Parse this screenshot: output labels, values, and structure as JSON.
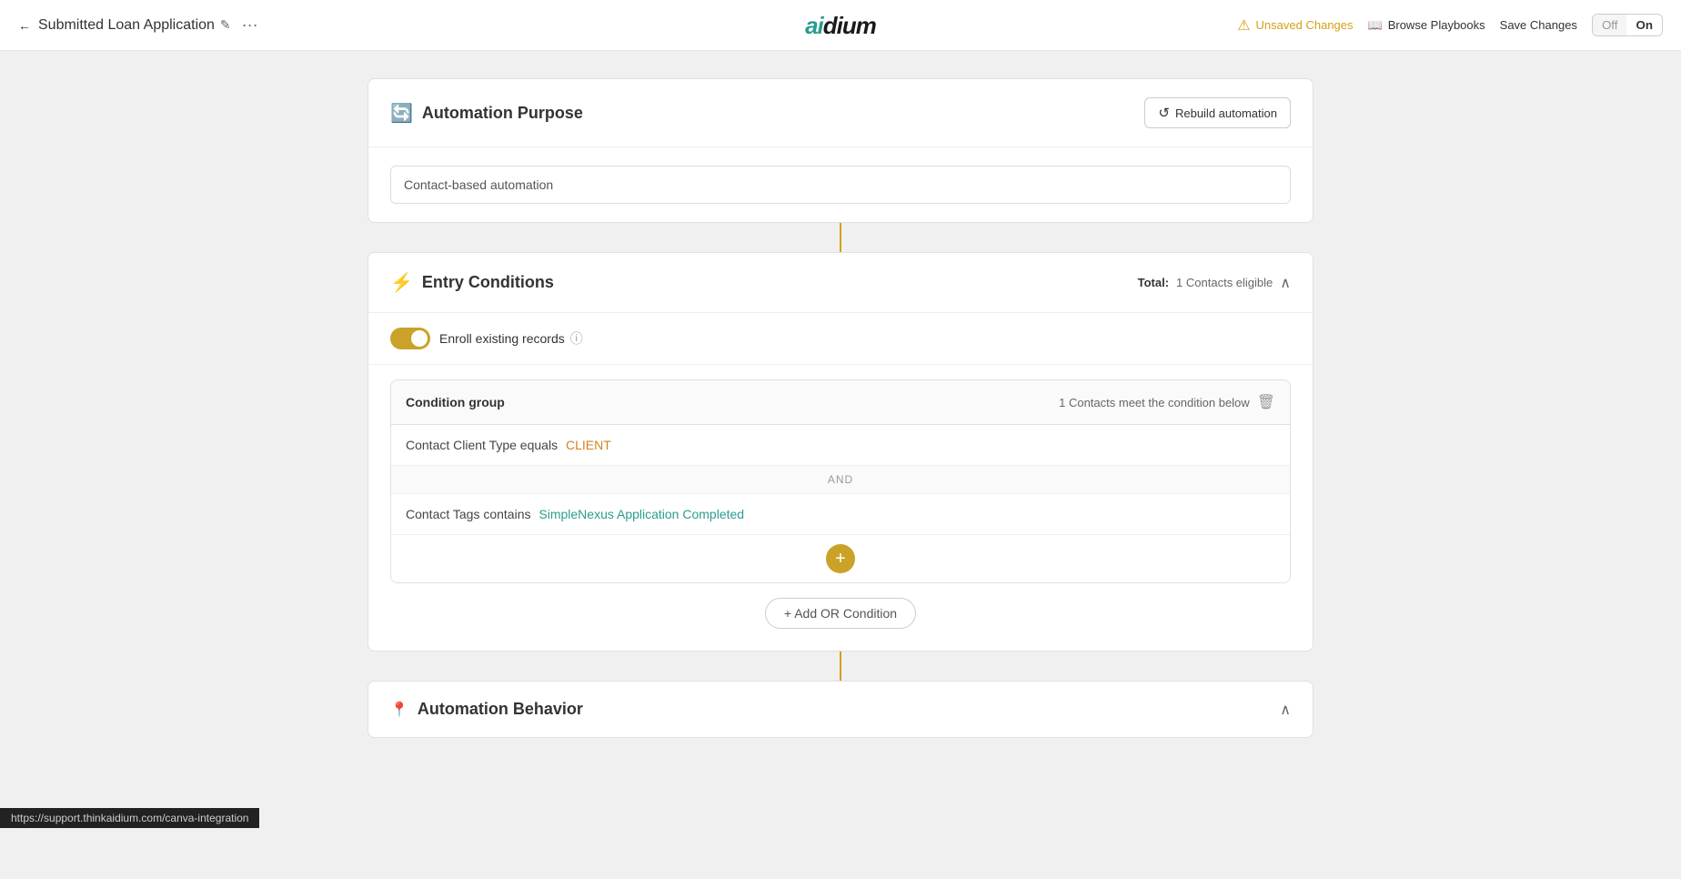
{
  "nav": {
    "back_label": "←",
    "title": "Submitted Loan Application",
    "edit_icon": "✏",
    "more_icon": "···",
    "logo": "aidium",
    "unsaved_label": "Unsaved Changes",
    "browse_label": "Browse Playbooks",
    "save_label": "Save Changes",
    "toggle_off": "Off",
    "toggle_on": "On"
  },
  "automation_purpose": {
    "title": "Automation Purpose",
    "rebuild_label": "Rebuild automation",
    "input_value": "Contact-based automation"
  },
  "entry_conditions": {
    "title": "Entry Conditions",
    "total_label": "Total:",
    "total_value": "1 Contacts eligible",
    "enroll_label": "Enroll existing records",
    "condition_group": {
      "title": "Condition group",
      "meta": "1 Contacts meet the condition below",
      "condition1": {
        "prefix": "Contact Client Type equals",
        "value": "CLIENT"
      },
      "and_label": "AND",
      "condition2": {
        "prefix": "Contact Tags contains",
        "value": "SimpleNexus Application Completed"
      },
      "add_plus": "+"
    },
    "add_or_label": "+ Add OR Condition"
  },
  "automation_behavior": {
    "title": "Automation Behavior"
  },
  "status_bar": {
    "url": "https://support.thinkaidium.com/canva-integration"
  }
}
